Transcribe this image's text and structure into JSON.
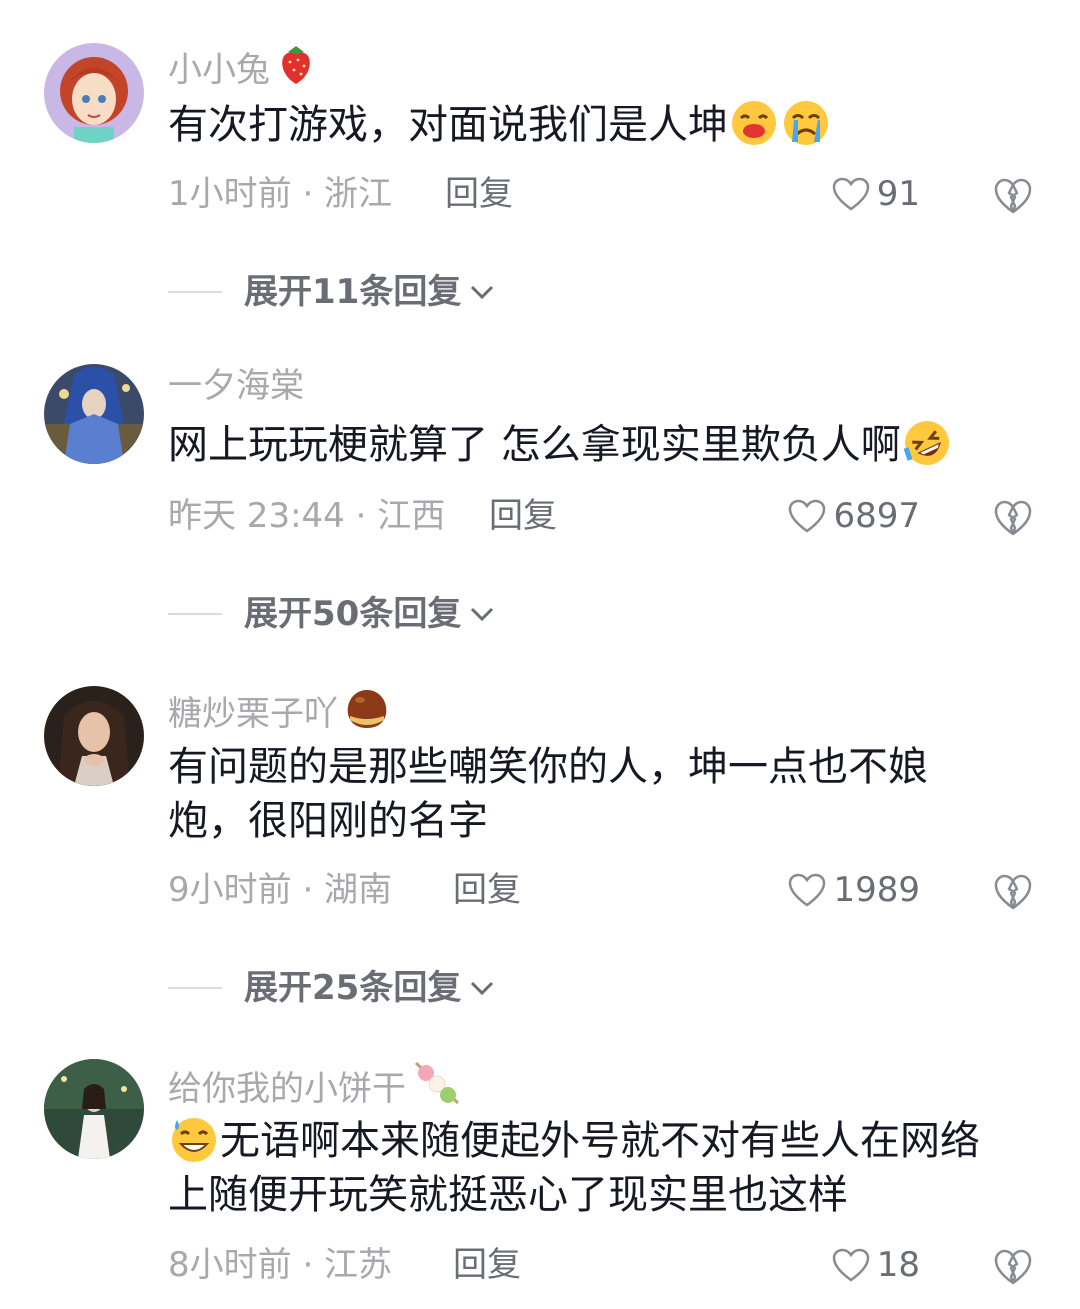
{
  "comments": [
    {
      "username": "小小兔",
      "badge_icon": "strawberry-icon",
      "text_lines": [
        "有次打游戏，对面说我们是人坤"
      ],
      "trailing_emojis": [
        "kiss-emoji",
        "crying-emoji"
      ],
      "time_location": "1小时前 · 浙江",
      "reply_label": "回复",
      "likes": "91",
      "expand_label": "展开11条回复"
    },
    {
      "username": "一夕海棠",
      "badge_icon": "",
      "text_lines": [
        "网上玩玩梗就算了 怎么拿现实里欺负人啊"
      ],
      "trailing_emojis": [
        "rofl-emoji"
      ],
      "time_location": "昨天 23:44 · 江西",
      "reply_label": "回复",
      "likes": "6897",
      "expand_label": "展开50条回复"
    },
    {
      "username": "糖炒栗子吖",
      "badge_icon": "chestnut-icon",
      "text_lines": [
        "有问题的是那些嘲笑你的人，坤一点也不娘",
        "炮，很阳刚的名字"
      ],
      "trailing_emojis": [],
      "time_location": "9小时前 · 湖南",
      "reply_label": "回复",
      "likes": "1989",
      "expand_label": "展开25条回复"
    },
    {
      "username": "给你我的小饼干",
      "badge_icon": "dango-icon",
      "leading_emoji": "sweat-smile-emoji",
      "text_lines": [
        "无语啊本来随便起外号就不对有些人在网络",
        "上随便开玩笑就挺恶心了现实里也这样"
      ],
      "trailing_emojis": [],
      "time_location": "8小时前 · 江苏",
      "reply_label": "回复",
      "likes": "18"
    }
  ],
  "colors": {
    "text": "#161823",
    "muted": "#a8a8ad",
    "action": "#6b6d75",
    "divider": "#dcdce0"
  }
}
